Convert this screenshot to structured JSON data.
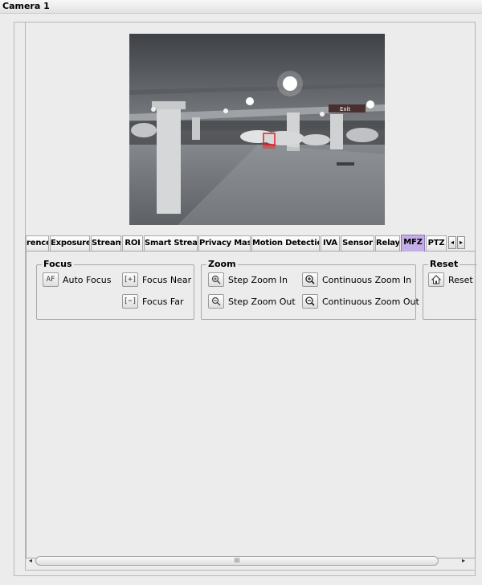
{
  "window": {
    "title": "Camera 1"
  },
  "preview": {
    "exit_sign": "Exit"
  },
  "tabs": [
    {
      "label": "rence"
    },
    {
      "label": "Exposure"
    },
    {
      "label": "Stream"
    },
    {
      "label": "ROI"
    },
    {
      "label": "Smart Stream"
    },
    {
      "label": "Privacy Mask"
    },
    {
      "label": "Motion Detection"
    },
    {
      "label": "IVA"
    },
    {
      "label": "Sensor"
    },
    {
      "label": "Relay"
    },
    {
      "label": "MFZ",
      "active": true
    },
    {
      "label": "PTZ"
    }
  ],
  "tab_scroll": {
    "left": "◂",
    "right": "▸"
  },
  "focus": {
    "title": "Focus",
    "auto_focus": {
      "label": "Auto Focus",
      "icon": "AF"
    },
    "focus_near": {
      "label": "Focus Near",
      "icon": "[+]"
    },
    "focus_far": {
      "label": "Focus Far",
      "icon": "[−]"
    }
  },
  "zoom": {
    "title": "Zoom",
    "step_in": {
      "label": "Step Zoom In"
    },
    "step_out": {
      "label": "Step Zoom Out"
    },
    "cont_in": {
      "label": "Continuous Zoom In"
    },
    "cont_out": {
      "label": "Continuous Zoom Out"
    }
  },
  "reset": {
    "title": "Reset",
    "button": {
      "label": "Reset"
    }
  },
  "scrollbar": {
    "grip": "III",
    "left": "◂",
    "right": "▸"
  },
  "colors": {
    "active_tab": "#c4aee6",
    "background": "#ececec"
  }
}
